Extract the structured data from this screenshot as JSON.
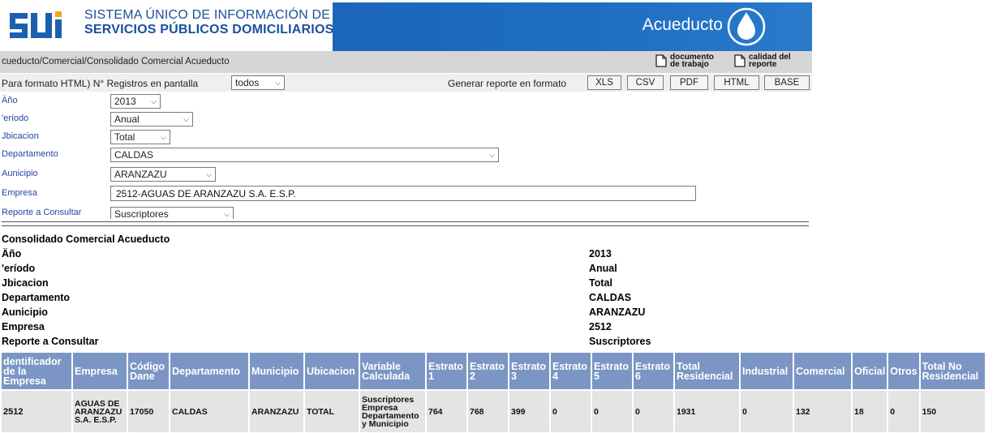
{
  "header": {
    "logo_line1": "SISTEMA ÚNICO DE INFORMACIÓN DE",
    "logo_line2": "SERVICIOS PÚBLICOS DOMICILIARIOS",
    "section_title": "Acueducto",
    "brand_color": "#1f6fc2"
  },
  "breadcrumb": "cueducto/Comercial/Consolidado Comercial Acueducto",
  "links": {
    "documento_trabajo": "documento de trabajo",
    "calidad_reporte": "calidad del reporte"
  },
  "controls": {
    "registros_label": "Para formato HTML) N° Registros en pantalla",
    "registros_value": "todos",
    "generar_label": "Generar reporte en formato",
    "formats": [
      "XLS",
      "CSV",
      "PDF",
      "HTML",
      "BASE"
    ]
  },
  "filters": [
    {
      "label": "Äño",
      "value": "2013",
      "type": "select"
    },
    {
      "label": "'eríodo",
      "value": "Anual",
      "type": "select"
    },
    {
      "label": "Jbicacion",
      "value": "Total",
      "type": "select"
    },
    {
      "label": "Departamento",
      "value": "CALDAS",
      "type": "select"
    },
    {
      "label": "Aunicipio",
      "value": "ARANZAZU",
      "type": "select"
    },
    {
      "label": "Empresa",
      "value": "2512-AGUAS DE ARANZAZU S.A. E.S.P.",
      "type": "input"
    },
    {
      "label": "Reporte a Consultar",
      "value": "Suscriptores",
      "type": "select"
    }
  ],
  "summary": {
    "title": "Consolidado Comercial Acueducto",
    "rows": [
      {
        "label": "Äño",
        "value": "2013"
      },
      {
        "label": "'eríodo",
        "value": "Anual"
      },
      {
        "label": "Jbicacion",
        "value": "Total"
      },
      {
        "label": "Departamento",
        "value": "CALDAS"
      },
      {
        "label": "Aunicipio",
        "value": "ARANZAZU"
      },
      {
        "label": "Empresa",
        "value": "2512"
      },
      {
        "label": "Reporte a Consultar",
        "value": "Suscriptores"
      }
    ]
  },
  "table": {
    "headers": [
      "dentificador de la Empresa",
      "Empresa",
      "Código Dane",
      "Departamento",
      "Municipio",
      "Ubicacion",
      "Variable Calculada",
      "Estrato 1",
      "Estrato 2",
      "Estrato 3",
      "Estrato 4",
      "Estrato 5",
      "Estrato 6",
      "Total Residencial",
      "Industrial",
      "Comercial",
      "Oficial",
      "Otros",
      "Total No Residencial"
    ],
    "rows": [
      [
        "2512",
        "AGUAS DE ARANZAZU S.A. E.S.P.",
        "17050",
        "CALDAS",
        "ARANZAZU",
        "TOTAL",
        "Suscriptores Empresa Departamento y Municipio",
        "764",
        "768",
        "399",
        "0",
        "0",
        "0",
        "1931",
        "0",
        "132",
        "18",
        "0",
        "150"
      ]
    ],
    "header_color": "#7b96c4",
    "row_color": "#e4e4e4"
  }
}
